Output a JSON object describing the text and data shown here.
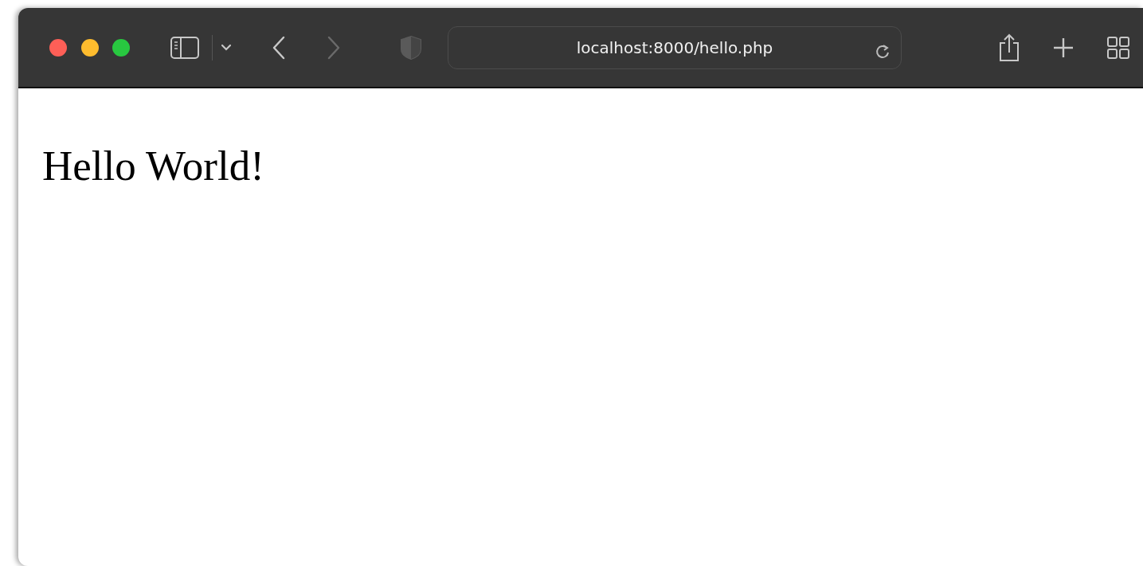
{
  "toolbar": {
    "back_button": {
      "disabled": false
    },
    "forward_button": {
      "disabled": true
    },
    "address": "localhost:8000/hello.php"
  },
  "page": {
    "heading": "Hello World!"
  }
}
